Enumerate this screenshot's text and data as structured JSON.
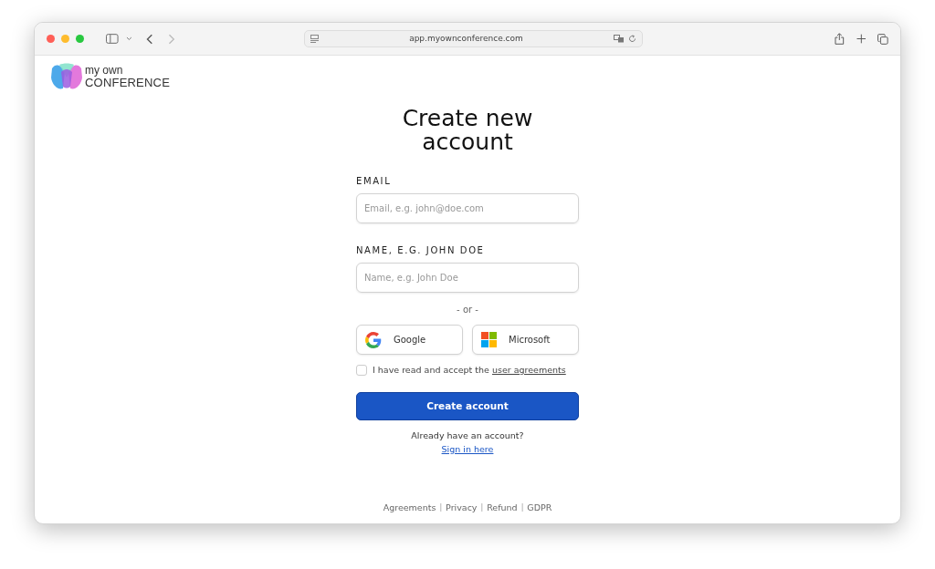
{
  "browser": {
    "url": "app.myownconference.com"
  },
  "logo": {
    "line_1": "my own",
    "line_2": "CONFERENCE"
  },
  "title": "Create new account",
  "fields": [
    {
      "label": "EMAIL",
      "placeholder": "Email, e.g. john@doe.com"
    },
    {
      "label": "NAME, E.G. JOHN DOE",
      "placeholder": "Name, e.g. John Doe"
    }
  ],
  "divider_text": "- or -",
  "providers": [
    {
      "kind": "google",
      "label": "Google"
    },
    {
      "kind": "microsoft",
      "label": "Microsoft"
    }
  ],
  "agreement": {
    "text": "I have read and accept the ",
    "link": "user agreements",
    "checked": false
  },
  "submit": "Create account",
  "signin": {
    "prompt": "Already have an account?",
    "link": "Sign in here"
  },
  "footer": {
    "separator": "|",
    "links": [
      "Agreements",
      "Privacy",
      "Refund",
      "GDPR"
    ]
  }
}
